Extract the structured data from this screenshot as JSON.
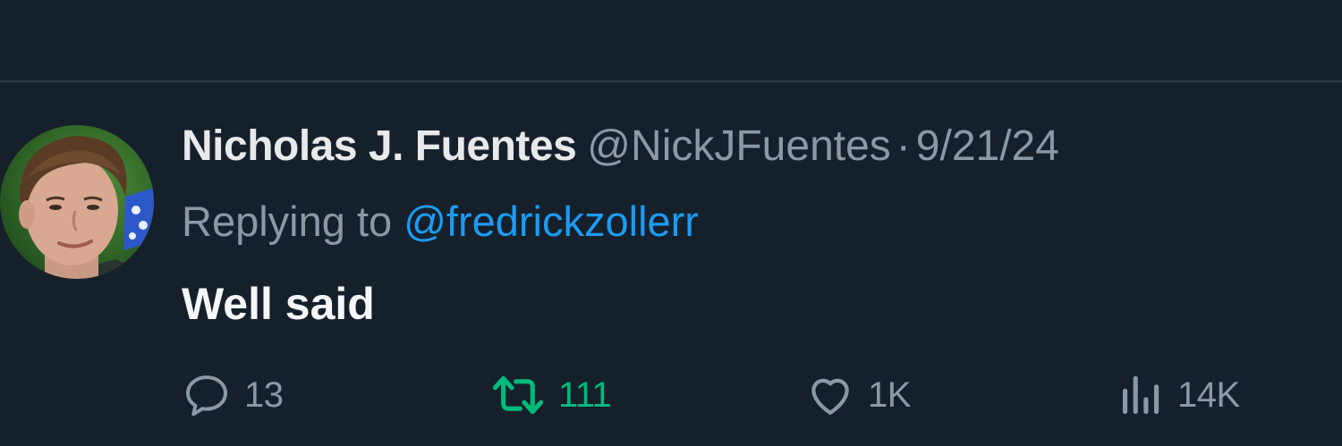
{
  "tweet": {
    "display_name": "Nicholas J. Fuentes",
    "handle": "@NickJFuentes",
    "separator": "·",
    "date": "9/21/24",
    "replying_prefix": "Replying to",
    "replying_to": "@fredrickzollerr",
    "text": "Well said"
  },
  "actions": {
    "reply": {
      "icon": "reply-bubble-icon",
      "count": "13"
    },
    "retweet": {
      "icon": "retweet-icon",
      "count": "111",
      "active": true,
      "color": "#00ba7c"
    },
    "like": {
      "icon": "heart-icon",
      "count": "1K"
    },
    "views": {
      "icon": "analytics-bars-icon",
      "count": "14K"
    }
  },
  "colors": {
    "background": "#16202b",
    "primary_text": "#e7e9ea",
    "secondary_text": "#8b98a5",
    "link": "#1d9bf0",
    "retweet_active": "#00ba7c"
  }
}
